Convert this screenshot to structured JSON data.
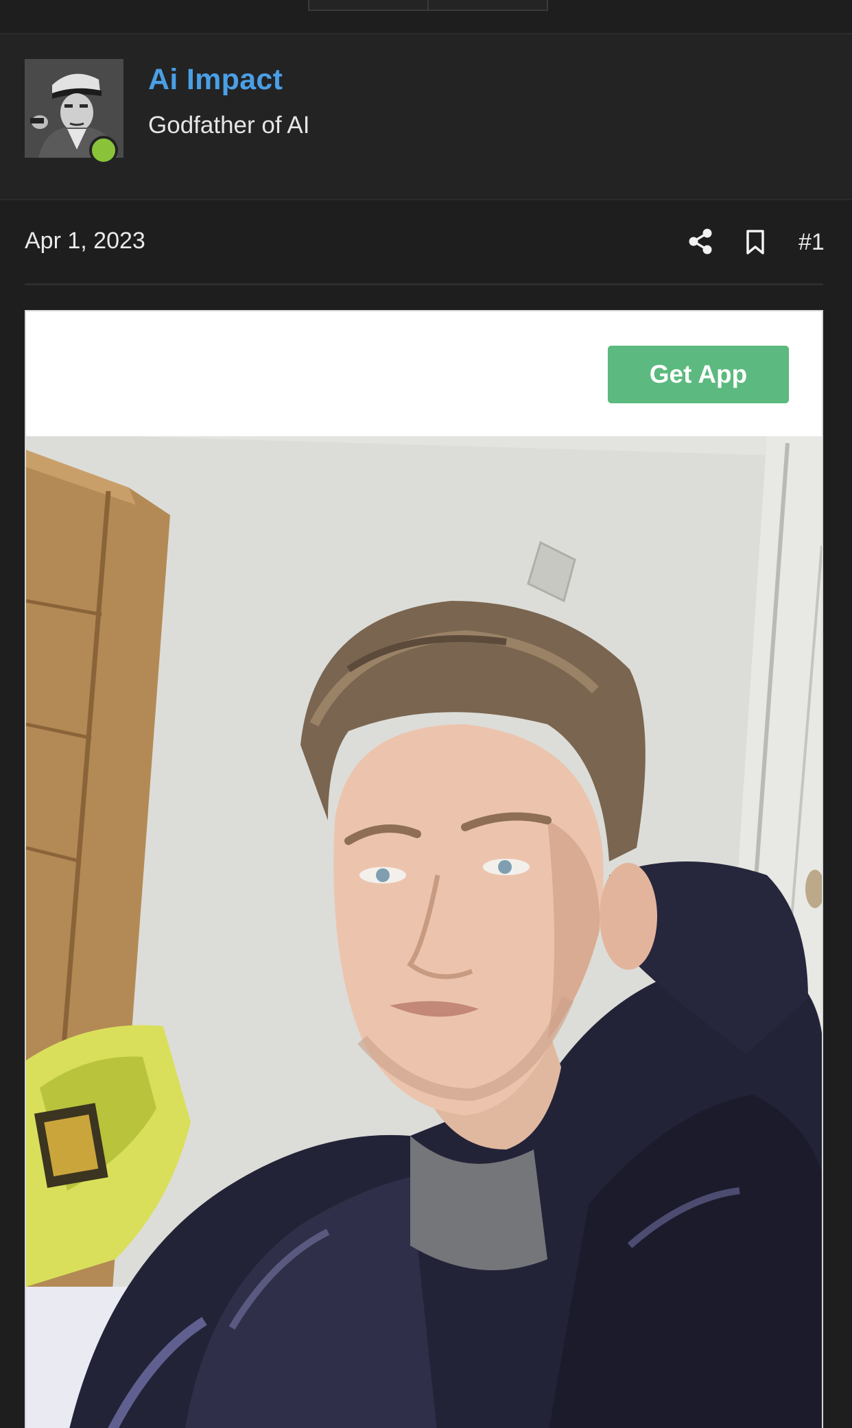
{
  "user": {
    "name": "Ai Impact",
    "title": "Godfather of AI",
    "online": true
  },
  "post": {
    "date": "Apr 1, 2023",
    "number": "#1",
    "actions": {
      "share_icon": "share-icon",
      "bookmark_icon": "bookmark-icon"
    }
  },
  "embed": {
    "cta_label": "Get App",
    "image_alt": "Selfie of a young man in a dark puffer jacket in a room"
  },
  "colors": {
    "background": "#1e1e1f",
    "username": "#4a9fe6",
    "online": "#8ac33a",
    "cta": "#5cb97f"
  }
}
